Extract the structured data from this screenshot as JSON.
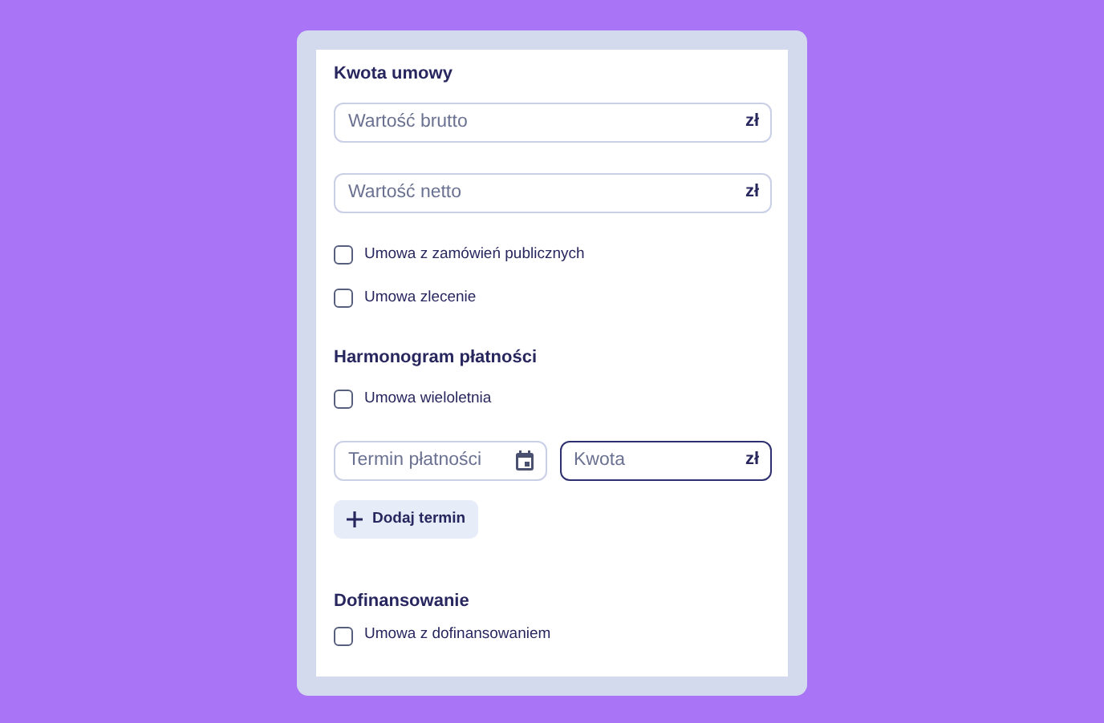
{
  "sections": [
    {
      "title": "Kwota umowy",
      "items": [
        {
          "kind": "field",
          "placeholder": "Wartość brutto",
          "suffix": "zł",
          "focused": false
        },
        {
          "kind": "field",
          "placeholder": "Wartość netto",
          "suffix": "zł",
          "focused": false
        },
        {
          "kind": "checkbox",
          "label": "Umowa z zamówień publicznych",
          "checked": false
        },
        {
          "kind": "checkbox",
          "label": "Umowa zlecenie",
          "checked": false
        }
      ]
    },
    {
      "title": "Harmonogram płatności",
      "items": [
        {
          "kind": "checkbox",
          "label": "Umowa wieloletnia",
          "checked": false
        },
        {
          "kind": "field-row",
          "fields": [
            {
              "kind": "date",
              "placeholder": "Termin płatności",
              "focused": false
            },
            {
              "placeholder": "Kwota",
              "suffix": "zł",
              "focused": true
            }
          ]
        },
        {
          "kind": "button",
          "label": "Dodaj termin"
        }
      ]
    },
    {
      "title": "Dofinansowanie",
      "items": [
        {
          "kind": "checkbox",
          "label": "Umowa z dofinansowaniem",
          "checked": false
        }
      ]
    }
  ]
}
